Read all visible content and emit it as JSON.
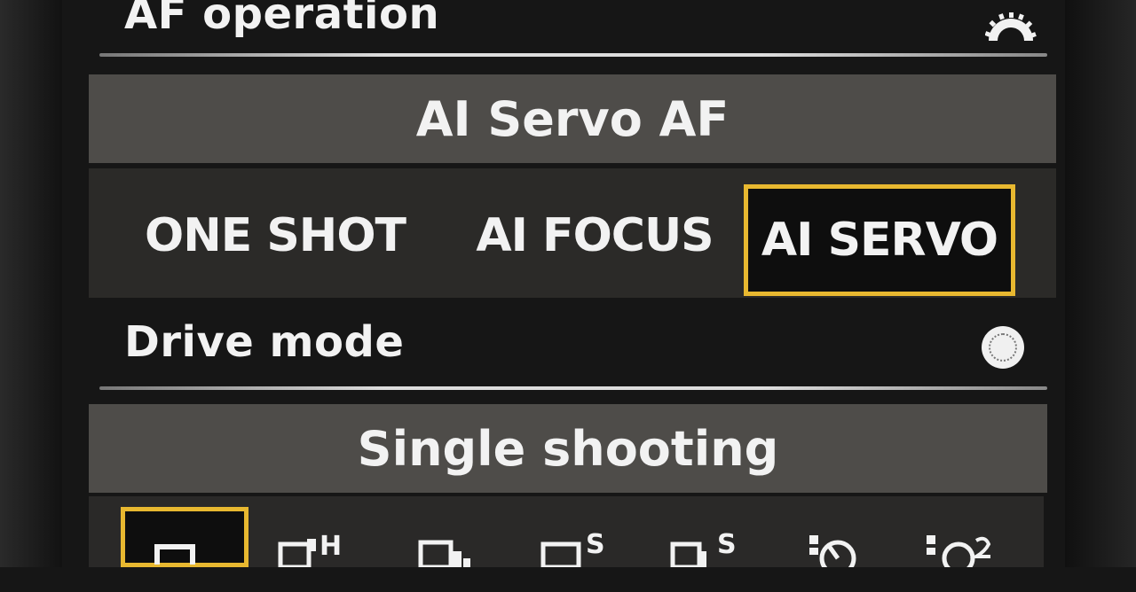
{
  "af_operation": {
    "title": "AF operation",
    "current_value": "AI Servo AF",
    "options": [
      "ONE SHOT",
      "AI FOCUS",
      "AI SERVO"
    ],
    "selected": "AI SERVO"
  },
  "drive_mode": {
    "title": "Drive mode",
    "current_value": "Single shooting",
    "icons": [
      {
        "name": "single-shooting-icon",
        "selected": true
      },
      {
        "name": "high-speed-continuous-icon",
        "letter": "H"
      },
      {
        "name": "low-speed-continuous-icon"
      },
      {
        "name": "silent-single-shooting-icon",
        "letter": "S"
      },
      {
        "name": "silent-continuous-icon",
        "letter": "S"
      },
      {
        "name": "self-timer-10s-icon"
      },
      {
        "name": "self-timer-2s-icon"
      }
    ]
  },
  "colors": {
    "selection": "#e8b830",
    "value_bar": "#4e4c49",
    "background": "#161616"
  }
}
